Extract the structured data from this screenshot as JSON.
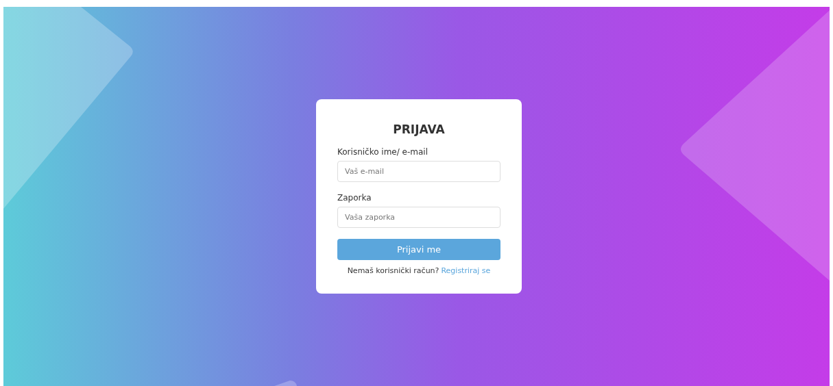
{
  "login_card": {
    "title": "PRIJAVA",
    "fields": [
      {
        "label": "Korisničko ime/ e-mail",
        "placeholder": "Vaš e-mail"
      },
      {
        "label": "Zaporka",
        "placeholder": "Vaša zaporka"
      }
    ],
    "submit_button": "Prijavi me",
    "register_prompt": "Nemaš korisnički račun?",
    "register_link": "Registriraj se"
  }
}
